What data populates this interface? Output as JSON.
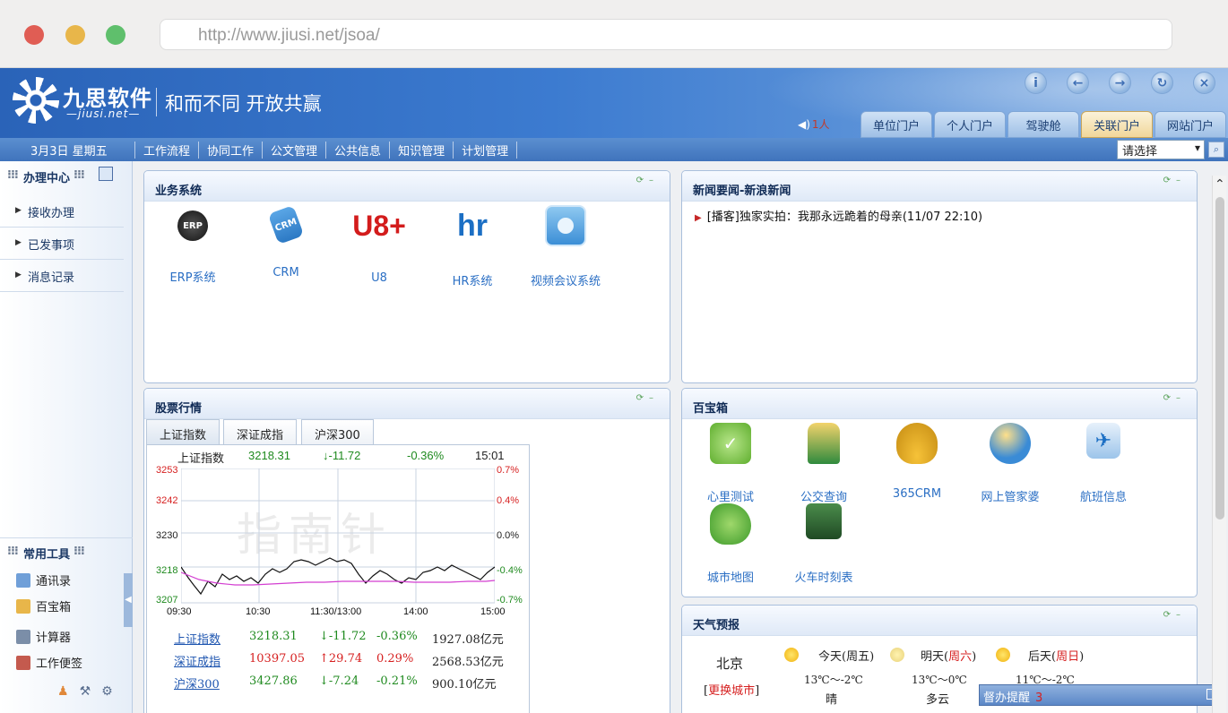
{
  "browser": {
    "url": "http://www.jiusi.net/jsoa/"
  },
  "header": {
    "logo_cn": "九思软件",
    "logo_en": "—jiusi.net—",
    "slogan": "和而不同 开放共赢",
    "online_count": "1人",
    "tool_icons": [
      "info-icon",
      "back-icon",
      "forward-icon",
      "refresh-icon",
      "close-icon"
    ],
    "portal_tabs": [
      "单位门户",
      "个人门户",
      "驾驶舱",
      "关联门户",
      "网站门户"
    ],
    "active_portal": "关联门户"
  },
  "navbar": {
    "date": "3月3日  星期五",
    "menu": [
      "工作流程",
      "协同工作",
      "公文管理",
      "公共信息",
      "知识管理",
      "计划管理"
    ],
    "select_value": "请选择"
  },
  "sidebar": {
    "center_title": "办理中心",
    "items": [
      "接收办理",
      "已发事项",
      "消息记录"
    ],
    "tools_title": "常用工具",
    "tools": [
      "通讯录",
      "百宝箱",
      "计算器",
      "工作便签"
    ]
  },
  "business": {
    "title": "业务系统",
    "tiles": [
      {
        "label": "ERP系统",
        "icon": "erp-icon",
        "glyph": "ERP"
      },
      {
        "label": "CRM",
        "icon": "crm-icon",
        "glyph": "CRM"
      },
      {
        "label": "U8",
        "icon": "u8-icon",
        "glyph": "U8+"
      },
      {
        "label": "HR系统",
        "icon": "hr-icon",
        "glyph": "hr"
      },
      {
        "label": "视频会议系统",
        "icon": "video-conference-icon",
        "glyph": ""
      }
    ]
  },
  "news": {
    "title": "新闻要闻-新浪新闻",
    "items": [
      "[播客]独家实拍：我那永远跪着的母亲(11/07 22:10)"
    ]
  },
  "stock": {
    "title": "股票行情",
    "tabs": [
      "上证指数",
      "深证成指",
      "沪深300"
    ],
    "quote": {
      "name": "上证指数",
      "price": "3218.31",
      "change": "↓-11.72",
      "pct": "-0.36%",
      "time": "15:01"
    },
    "y_left": [
      "3253",
      "3242",
      "3230",
      "3218",
      "3207"
    ],
    "y_right": [
      "0.7%",
      "0.4%",
      "0.0%",
      "-0.4%",
      "-0.7%"
    ],
    "x_labels": [
      "09:30",
      "10:30",
      "11:30/13:00",
      "14:00",
      "15:00"
    ],
    "watermark": "指南针",
    "rows": [
      {
        "name": "上证指数",
        "price": "3218.31",
        "change": "↓-11.72",
        "pct": "-0.36%",
        "vol": "1927.08亿元",
        "trend": "down"
      },
      {
        "name": "深证成指",
        "price": "10397.05",
        "change": "↑29.74",
        "pct": "0.29%",
        "vol": "2568.53亿元",
        "trend": "up"
      },
      {
        "name": "沪深300",
        "price": "3427.86",
        "change": "↓-7.24",
        "pct": "-0.21%",
        "vol": "900.10亿元",
        "trend": "down"
      }
    ]
  },
  "toolbox": {
    "title": "百宝箱",
    "tiles": [
      {
        "label": "心里测试",
        "icon": "psychology-test-icon"
      },
      {
        "label": "公交查询",
        "icon": "bus-query-icon"
      },
      {
        "label": "365CRM",
        "icon": "crm365-icon"
      },
      {
        "label": "网上管家婆",
        "icon": "online-housekeeper-icon"
      },
      {
        "label": "航班信息",
        "icon": "flight-info-icon"
      },
      {
        "label": "城市地图",
        "icon": "city-map-icon"
      },
      {
        "label": "火车时刻表",
        "icon": "train-schedule-icon"
      }
    ]
  },
  "weather": {
    "title": "天气预报",
    "city": "北京",
    "change_city": "更换城市",
    "days": [
      {
        "label": "今天",
        "weekday": "周五",
        "temp": "13℃～-2℃",
        "cond": "晴"
      },
      {
        "label": "明天",
        "weekday": "周六",
        "temp": "13℃～0℃",
        "cond": "多云"
      },
      {
        "label": "后天",
        "weekday": "周日",
        "temp": "11℃～-2℃",
        "cond": ""
      }
    ]
  },
  "reminder": {
    "label": "督办提醒",
    "count": "3"
  },
  "colors": {
    "brand": "#3c7bd0",
    "up": "#d62020",
    "down": "#1f8a1f",
    "link": "#2b6fc4"
  }
}
